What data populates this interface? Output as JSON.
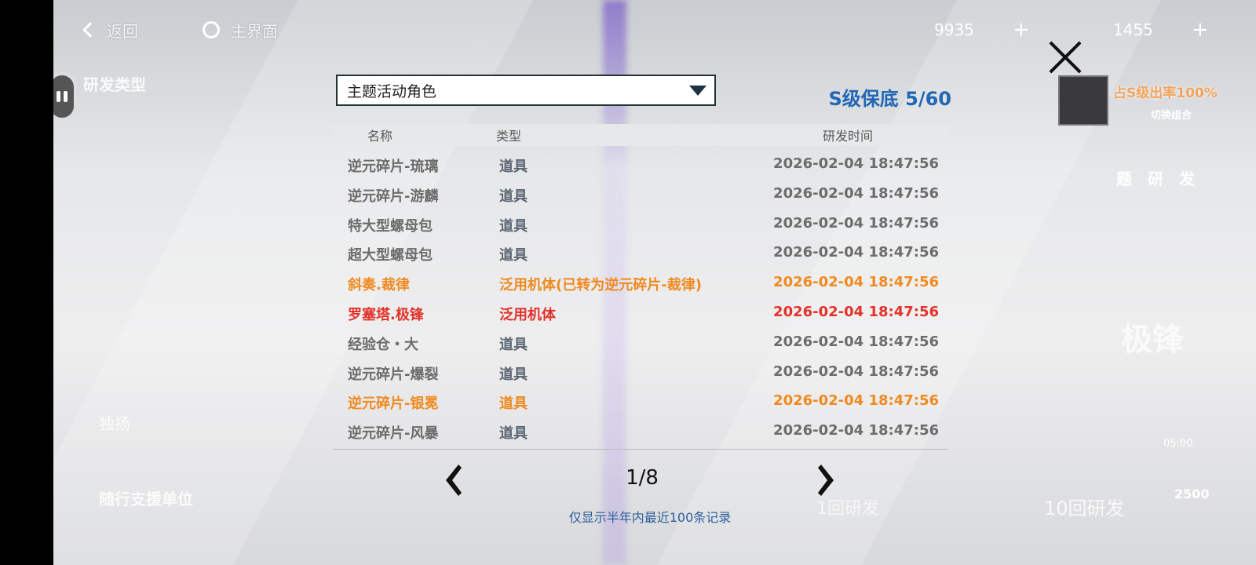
{
  "topbar": {
    "back_label": "返回",
    "home_label": "主界面",
    "currency1": "9935",
    "currency2": "1455",
    "plus": "+"
  },
  "side": {
    "dev_type_label": "研发类型",
    "rate_label": "占S级出率100%",
    "switch_label": "切换组合",
    "dev_label": "题研发",
    "solo_label": "独扬",
    "escort_label": "随行支援单位",
    "time_label": "05:00",
    "price": "2500",
    "single_draw": "1回研发",
    "ten_draw": "10回研发",
    "big_label": "极锋"
  },
  "modal": {
    "dropdown_value": "主题活动角色",
    "pity_label": "S级保底 5/60",
    "headers": {
      "name": "名称",
      "type": "类型",
      "time": "研发时间"
    },
    "rows": [
      {
        "name": "逆元碎片-琉璃",
        "type": "道具",
        "time": "2026-02-04 18:47:56",
        "rarity": "normal"
      },
      {
        "name": "逆元碎片-游麟",
        "type": "道具",
        "time": "2026-02-04 18:47:56",
        "rarity": "normal"
      },
      {
        "name": "特大型螺母包",
        "type": "道具",
        "time": "2026-02-04 18:47:56",
        "rarity": "normal"
      },
      {
        "name": "超大型螺母包",
        "type": "道具",
        "time": "2026-02-04 18:47:56",
        "rarity": "normal"
      },
      {
        "name": "斜奏.裁律",
        "type": "泛用机体(已转为逆元碎片-裁律)",
        "time": "2026-02-04 18:47:56",
        "rarity": "orange"
      },
      {
        "name": "罗塞塔.极锋",
        "type": "泛用机体",
        "time": "2026-02-04 18:47:56",
        "rarity": "red"
      },
      {
        "name": "经验仓・大",
        "type": "道具",
        "time": "2026-02-04 18:47:56",
        "rarity": "normal"
      },
      {
        "name": "逆元碎片-爆裂",
        "type": "道具",
        "time": "2026-02-04 18:47:56",
        "rarity": "normal"
      },
      {
        "name": "逆元碎片-银冕",
        "type": "道具",
        "time": "2026-02-04 18:47:56",
        "rarity": "orange"
      },
      {
        "name": "逆元碎片-风暴",
        "type": "道具",
        "time": "2026-02-04 18:47:56",
        "rarity": "normal"
      }
    ],
    "page_indicator": "1/8",
    "note": "仅显示半年内最近100条记录"
  },
  "colors": {
    "normal": "#6c6c6c",
    "orange": "#f08a20",
    "red": "#e2322a",
    "accent": "#2167b5"
  }
}
